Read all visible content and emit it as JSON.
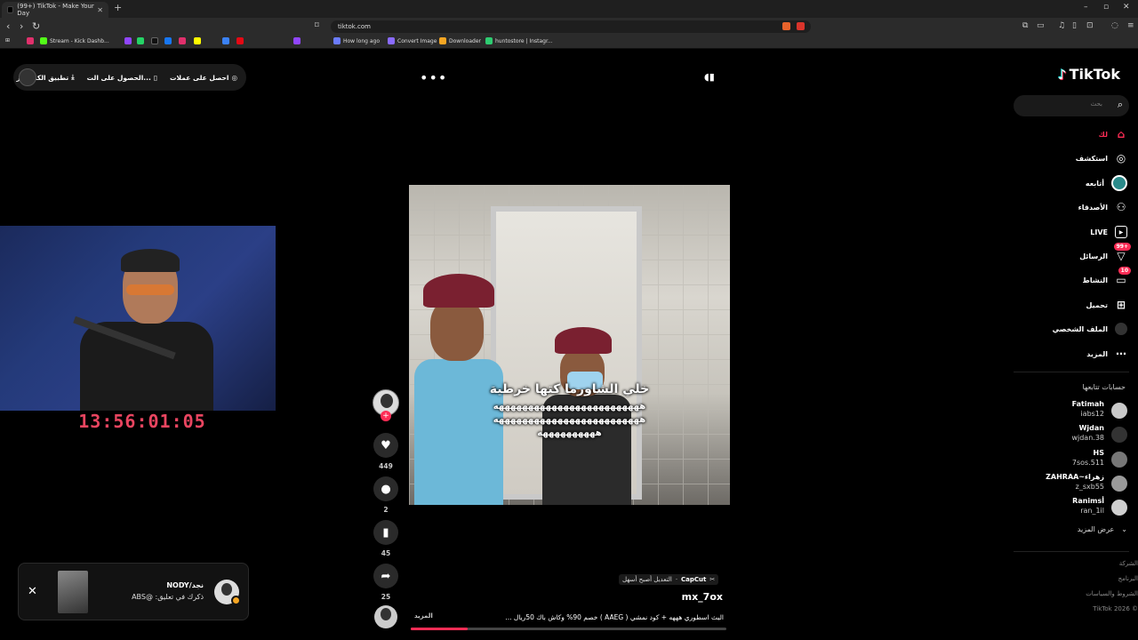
{
  "browser": {
    "tab_title": "(99+) TikTok - Make Your Day",
    "url": "tiktok.com",
    "bookmarks": [
      {
        "label": "Stream - Kick Dashb...",
        "color": "#53fc18"
      },
      {
        "label": "How long ago",
        "color": "#6b7cff"
      },
      {
        "label": "Convert Image",
        "color": "#8a6bff"
      },
      {
        "label": "Downloader",
        "color": "#f5a623"
      },
      {
        "label": "huntostore | Instagr...",
        "color": "#2ecc71"
      }
    ]
  },
  "topbar": {
    "coins": "احصل على عملات",
    "get_app": "الحصول على الت...",
    "desktop_app": "تطبيق الكمبيوتر"
  },
  "stream_overlay": {
    "timer": "13:56:01:05"
  },
  "video": {
    "caption_line1": "خلي الشاورما كتها خرطية",
    "caption_line2": "هههههههههههههههههههههههههه",
    "caption_line3": "هههههههههههههههههههههههههه",
    "caption_line4": "ههههههههههه",
    "capcut_brand": "CapCut",
    "capcut_text": "التعديل أصبح أسهل",
    "username": "mx_7ox",
    "description": "البث اسطوري هههه + كود نمشي ( AAEG ) خصم 90% وكاش باك 50ريال ...",
    "more_label": "المزيد",
    "progress": 0.18
  },
  "actions": {
    "likes": "449",
    "comments": "2",
    "saves": "45",
    "shares": "25"
  },
  "notification": {
    "title": "نجد/NODY",
    "text": "ذكرك في تعليق: @ABS"
  },
  "sidebar": {
    "logo": "TikTok",
    "search_placeholder": "بحث",
    "nav": [
      {
        "label": "لك",
        "icon": "home-icon"
      },
      {
        "label": "استكشف",
        "icon": "compass-icon"
      },
      {
        "label": "أتابعه",
        "icon": "following-avatar-icon"
      },
      {
        "label": "الأصدقاء",
        "icon": "friends-icon"
      },
      {
        "label": "LIVE",
        "icon": "live-icon"
      },
      {
        "label": "الرسائل",
        "icon": "messages-icon",
        "badge": "99+"
      },
      {
        "label": "النشاط",
        "icon": "activity-icon",
        "badge": "10"
      },
      {
        "label": "تحميل",
        "icon": "upload-icon"
      },
      {
        "label": "الملف الشخصي",
        "icon": "profile-icon"
      },
      {
        "label": "المزيد",
        "icon": "more-icon"
      }
    ],
    "following_title": "حسابات تتابعها",
    "accounts": [
      {
        "name": "Fatimah",
        "handle": "iabs12",
        "color": "#c9c9c9"
      },
      {
        "name": "Wjdan",
        "handle": "wjdan.38",
        "color": "#333333"
      },
      {
        "name": "HS",
        "handle": "7sos.511",
        "color": "#777777"
      },
      {
        "name": "ZAHRAA~زهراء",
        "handle": "z_sxb55",
        "color": "#9a9a9a"
      },
      {
        "name": "Ranimsأ",
        "handle": "ran_1il",
        "color": "#cfcfcf"
      }
    ],
    "see_more": "عرض المزيد",
    "footer": [
      "الشركة",
      "البرنامج",
      "الشروط والسياسات",
      "TikTok 2026 ©"
    ]
  }
}
